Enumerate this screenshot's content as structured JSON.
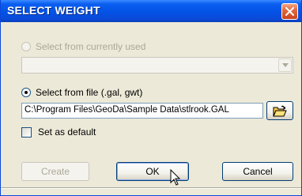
{
  "window": {
    "title": "SELECT WEIGHT"
  },
  "options": {
    "from_used_label": "Select from currently used",
    "from_file_label": "Select from file (.gal, gwt)",
    "file_path": "C:\\Program Files\\GeoDa\\Sample Data\\stlrook.GAL",
    "default_label": "Set as default"
  },
  "buttons": {
    "create_label": "Create",
    "ok_label": "OK",
    "cancel_label": "Cancel"
  },
  "icons": {
    "close": "close-icon",
    "dropdown": "chevron-down-icon",
    "open_folder": "open-folder-icon",
    "cursor": "mouse-pointer-icon"
  },
  "colors": {
    "titlebar": "#0452e6",
    "close_button": "#e06a40",
    "dialog_bg": "#ece9d8"
  }
}
